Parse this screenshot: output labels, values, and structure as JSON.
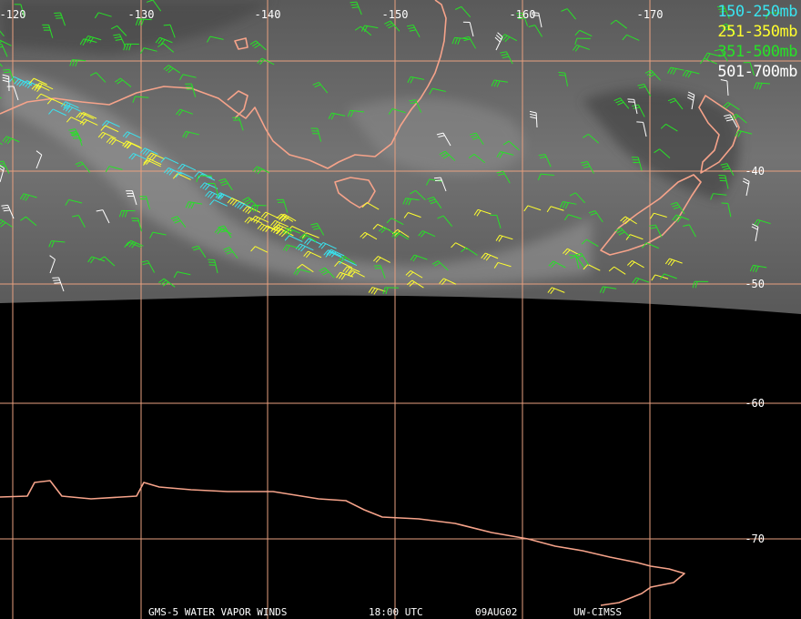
{
  "legend": [
    {
      "label": "150-250mb",
      "color": "#39e4f0"
    },
    {
      "label": "251-350mb",
      "color": "#ffff2e"
    },
    {
      "label": "351-500mb",
      "color": "#27e227"
    },
    {
      "label": "501-700mb",
      "color": "#ffffff"
    }
  ],
  "lon_labels": [
    "-120",
    "-130",
    "-140",
    "-150",
    "-160",
    "-170"
  ],
  "lat_labels": [
    "-40",
    "-50",
    "-60",
    "-70"
  ],
  "footer": {
    "product": "GMS-5 WATER VAPOR WINDS",
    "time": "18:00 UTC",
    "date": "09AUG02",
    "source": "UW-CIMSS"
  },
  "colors": {
    "grid": "#e8a07f",
    "coast": "#f6a38a",
    "background": "#000000"
  }
}
